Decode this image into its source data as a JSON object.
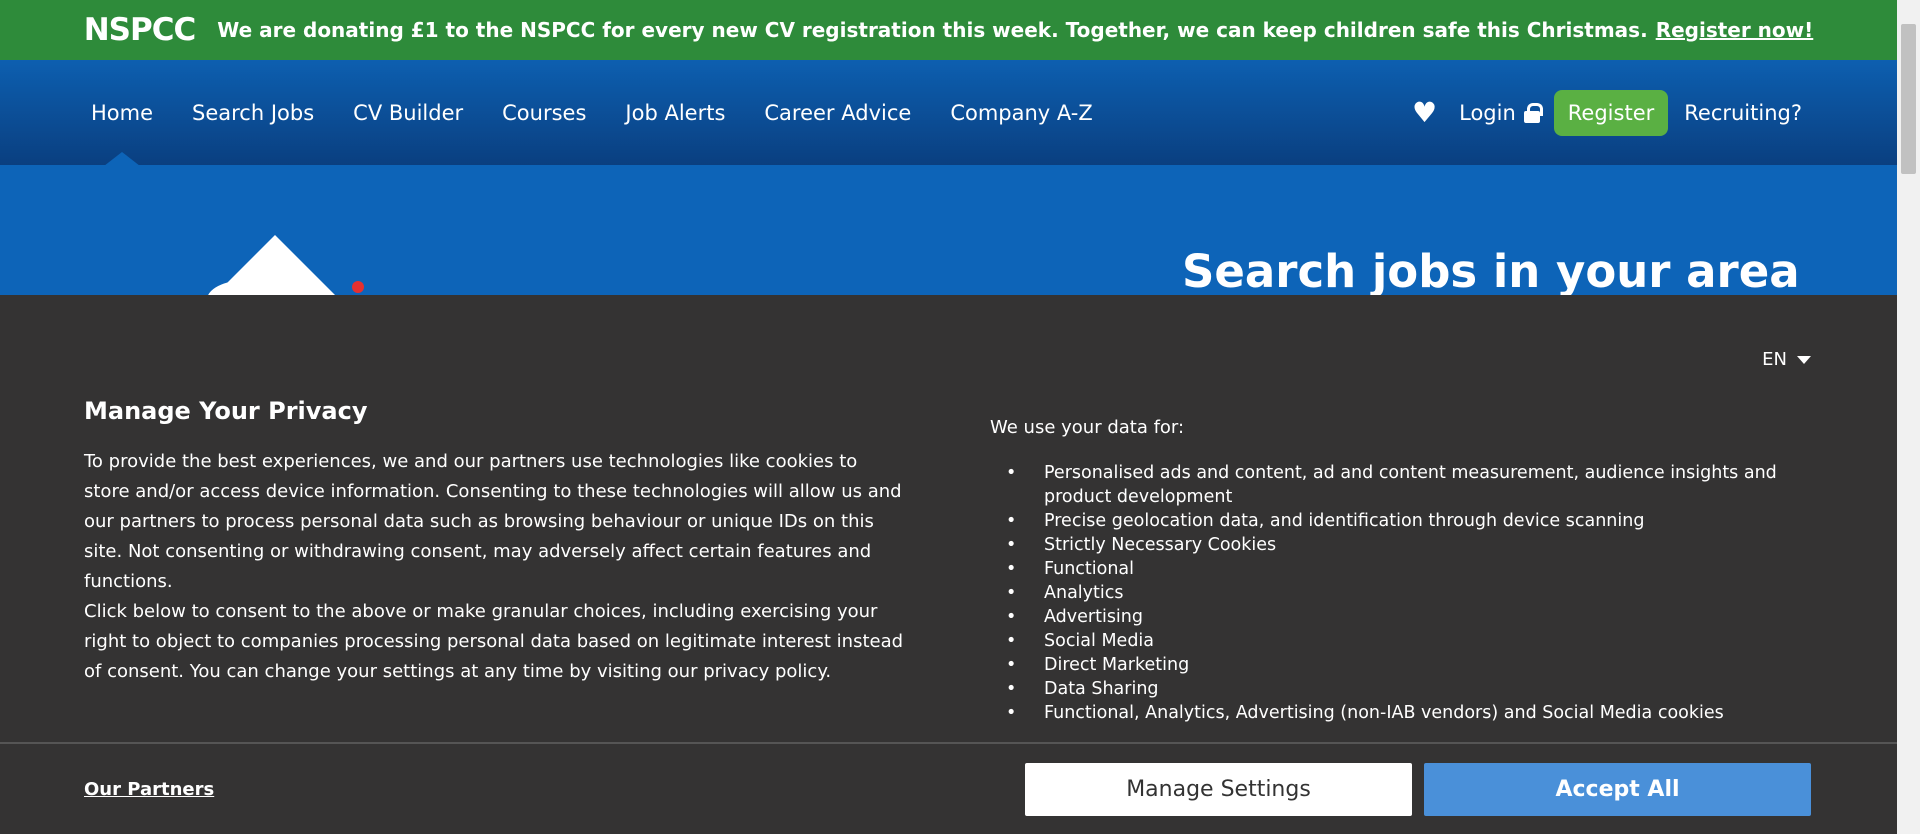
{
  "banner": {
    "logo": "NSPCC",
    "message": "We are donating £1 to the NSPCC for every new CV registration this week. Together, we can keep children safe this Christmas.",
    "link": "Register now!",
    "background_color": "#2e8b3a"
  },
  "nav": {
    "items": [
      "Home",
      "Search Jobs",
      "CV Builder",
      "Courses",
      "Job Alerts",
      "Career Advice",
      "Company A-Z"
    ],
    "active_item": "Home",
    "login": "Login",
    "register": "Register",
    "recruiting": "Recruiting?",
    "heart_icon": "heart-icon",
    "lock_icon": "lock-icon",
    "register_color": "#5ab043"
  },
  "hero": {
    "title": "Search jobs in your area"
  },
  "consent": {
    "language": "EN",
    "heading": "Manage Your Privacy",
    "body_1": "To provide the best experiences, we and our partners use technologies like cookies to store and/or access device information. Consenting to these technologies will allow us and our partners to process personal data such as browsing behaviour or unique IDs on this site. Not consenting or withdrawing consent, may adversely affect certain features and functions.",
    "body_2": "Click below to consent to the above or make granular choices, including exercising your right to object to companies processing personal data based on legitimate interest instead of consent. You can change your settings at any time by visiting our privacy policy.",
    "uses_heading": "We use your data for:",
    "uses": [
      "Personalised ads and content, ad and content measurement, audience insights and product development",
      "Precise geolocation data, and identification through device scanning",
      "Strictly Necessary Cookies",
      "Functional",
      "Analytics",
      "Advertising",
      "Social Media",
      "Direct Marketing",
      "Data Sharing",
      "Functional, Analytics, Advertising (non-IAB vendors) and Social Media cookies"
    ],
    "partners_link": "Our Partners",
    "manage_button": "Manage Settings",
    "accept_button": "Accept All",
    "accept_color": "#4a90d9"
  }
}
